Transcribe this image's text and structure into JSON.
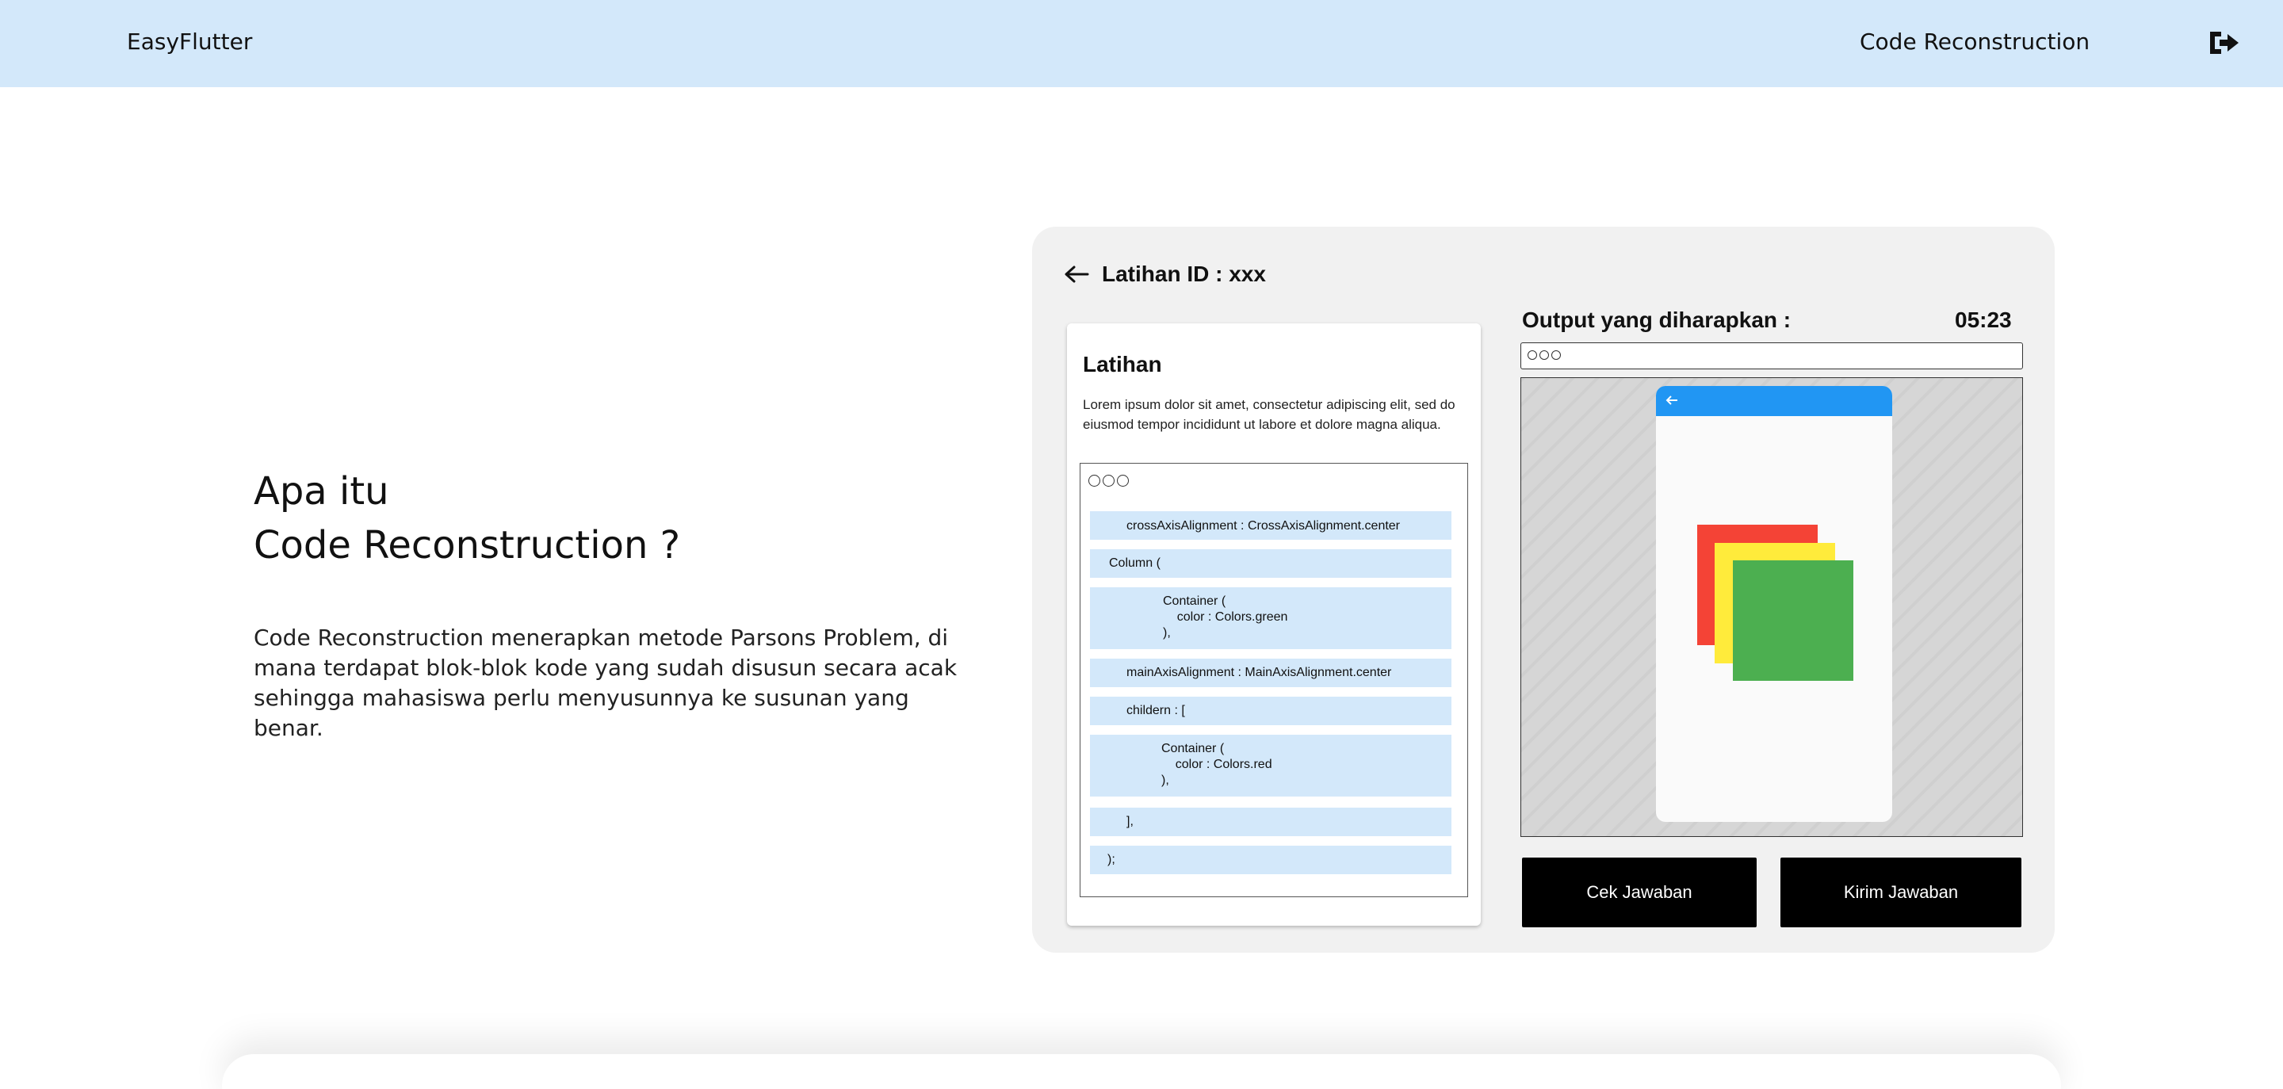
{
  "header": {
    "brand": "EasyFlutter",
    "nav_link": "Code Reconstruction",
    "logout_icon": "sign-out-icon"
  },
  "intro": {
    "title_line1": "Apa itu",
    "title_line2": "Code Reconstruction ?",
    "body": "Code Reconstruction menerapkan metode Parsons Problem, di mana terdapat blok-blok kode yang sudah disusun secara acak sehingga mahasiswa perlu menyusunnya ke susunan yang benar."
  },
  "preview_card": {
    "title": "Latihan ID : xxx",
    "back_icon": "arrow-left-icon",
    "panel": {
      "title": "Latihan",
      "description": "Lorem ipsum dolor sit amet, consectetur adipiscing elit, sed do eiusmod tempor incididunt ut labore et dolore magna aliqua.",
      "code_blocks": [
        {
          "lines": [
            "crossAxisAlignment : CrossAxisAlignment.center"
          ]
        },
        {
          "lines": [
            "Column ("
          ]
        },
        {
          "lines": [
            "Container (",
            "    color : Colors.green",
            "),"
          ]
        },
        {
          "lines": [
            "mainAxisAlignment : MainAxisAlignment.center"
          ]
        },
        {
          "lines": [
            "childern : ["
          ]
        },
        {
          "lines": [
            "Container (",
            "    color : Colors.red",
            "),"
          ]
        },
        {
          "lines": [
            "],"
          ]
        },
        {
          "lines": [
            ");"
          ]
        }
      ]
    },
    "output": {
      "label": "Output yang diharapkan :",
      "timer": "05:23",
      "colors": {
        "appbar": "#2196f3",
        "red": "#f44336",
        "yellow": "#ffeb3b",
        "green": "#4caf50"
      }
    },
    "buttons": {
      "check": "Cek Jawaban",
      "submit": "Kirim Jawaban"
    }
  }
}
